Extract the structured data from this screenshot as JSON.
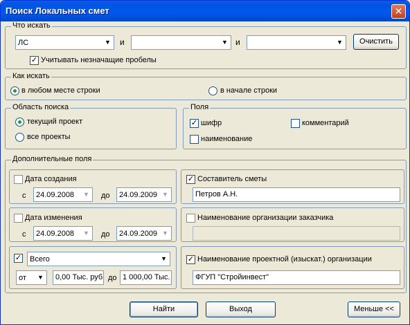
{
  "window": {
    "title": "Поиск Локальных смет",
    "close": "✕"
  },
  "what": {
    "title": "Что искать",
    "field1": "ЛС",
    "and1": "и",
    "field2": "",
    "and2": "и",
    "field3": "",
    "clear": "Очистить",
    "ignore_spaces": "Учитывать незначащие пробелы"
  },
  "how": {
    "title": "Как искать",
    "anywhere": "в любом месте строки",
    "start": "в начале строки"
  },
  "area": {
    "title": "Область поиска",
    "current": "текущий проект",
    "all": "все проекты"
  },
  "fields": {
    "title": "Поля",
    "code": "шифр",
    "comment": "комментарий",
    "name": "наименование"
  },
  "extra": {
    "title": "Дополнительные поля",
    "created": {
      "label": "Дата создания",
      "from": "с",
      "from_value": "24.09.2008",
      "to": "до",
      "to_value": "24.09.2009"
    },
    "author": {
      "label": "Составитель сметы",
      "value": "Петров А.Н."
    },
    "changed": {
      "label": "Дата изменения",
      "from": "с",
      "from_value": "24.09.2008",
      "to": "до",
      "to_value": "24.09.2009"
    },
    "customer": {
      "label": "Наименование организации заказчика",
      "value": ""
    },
    "total": {
      "select": "Всего",
      "op": "от",
      "min": "0,00 Тыс. руб",
      "to": "до",
      "max": "1 000,00 Тыс."
    },
    "design_org": {
      "label": "Наименование проектной (изыскат.) организации",
      "value": "ФГУП \"Стройинвест\""
    }
  },
  "buttons": {
    "find": "Найти",
    "exit": "Выход",
    "less": "Меньше <<"
  }
}
